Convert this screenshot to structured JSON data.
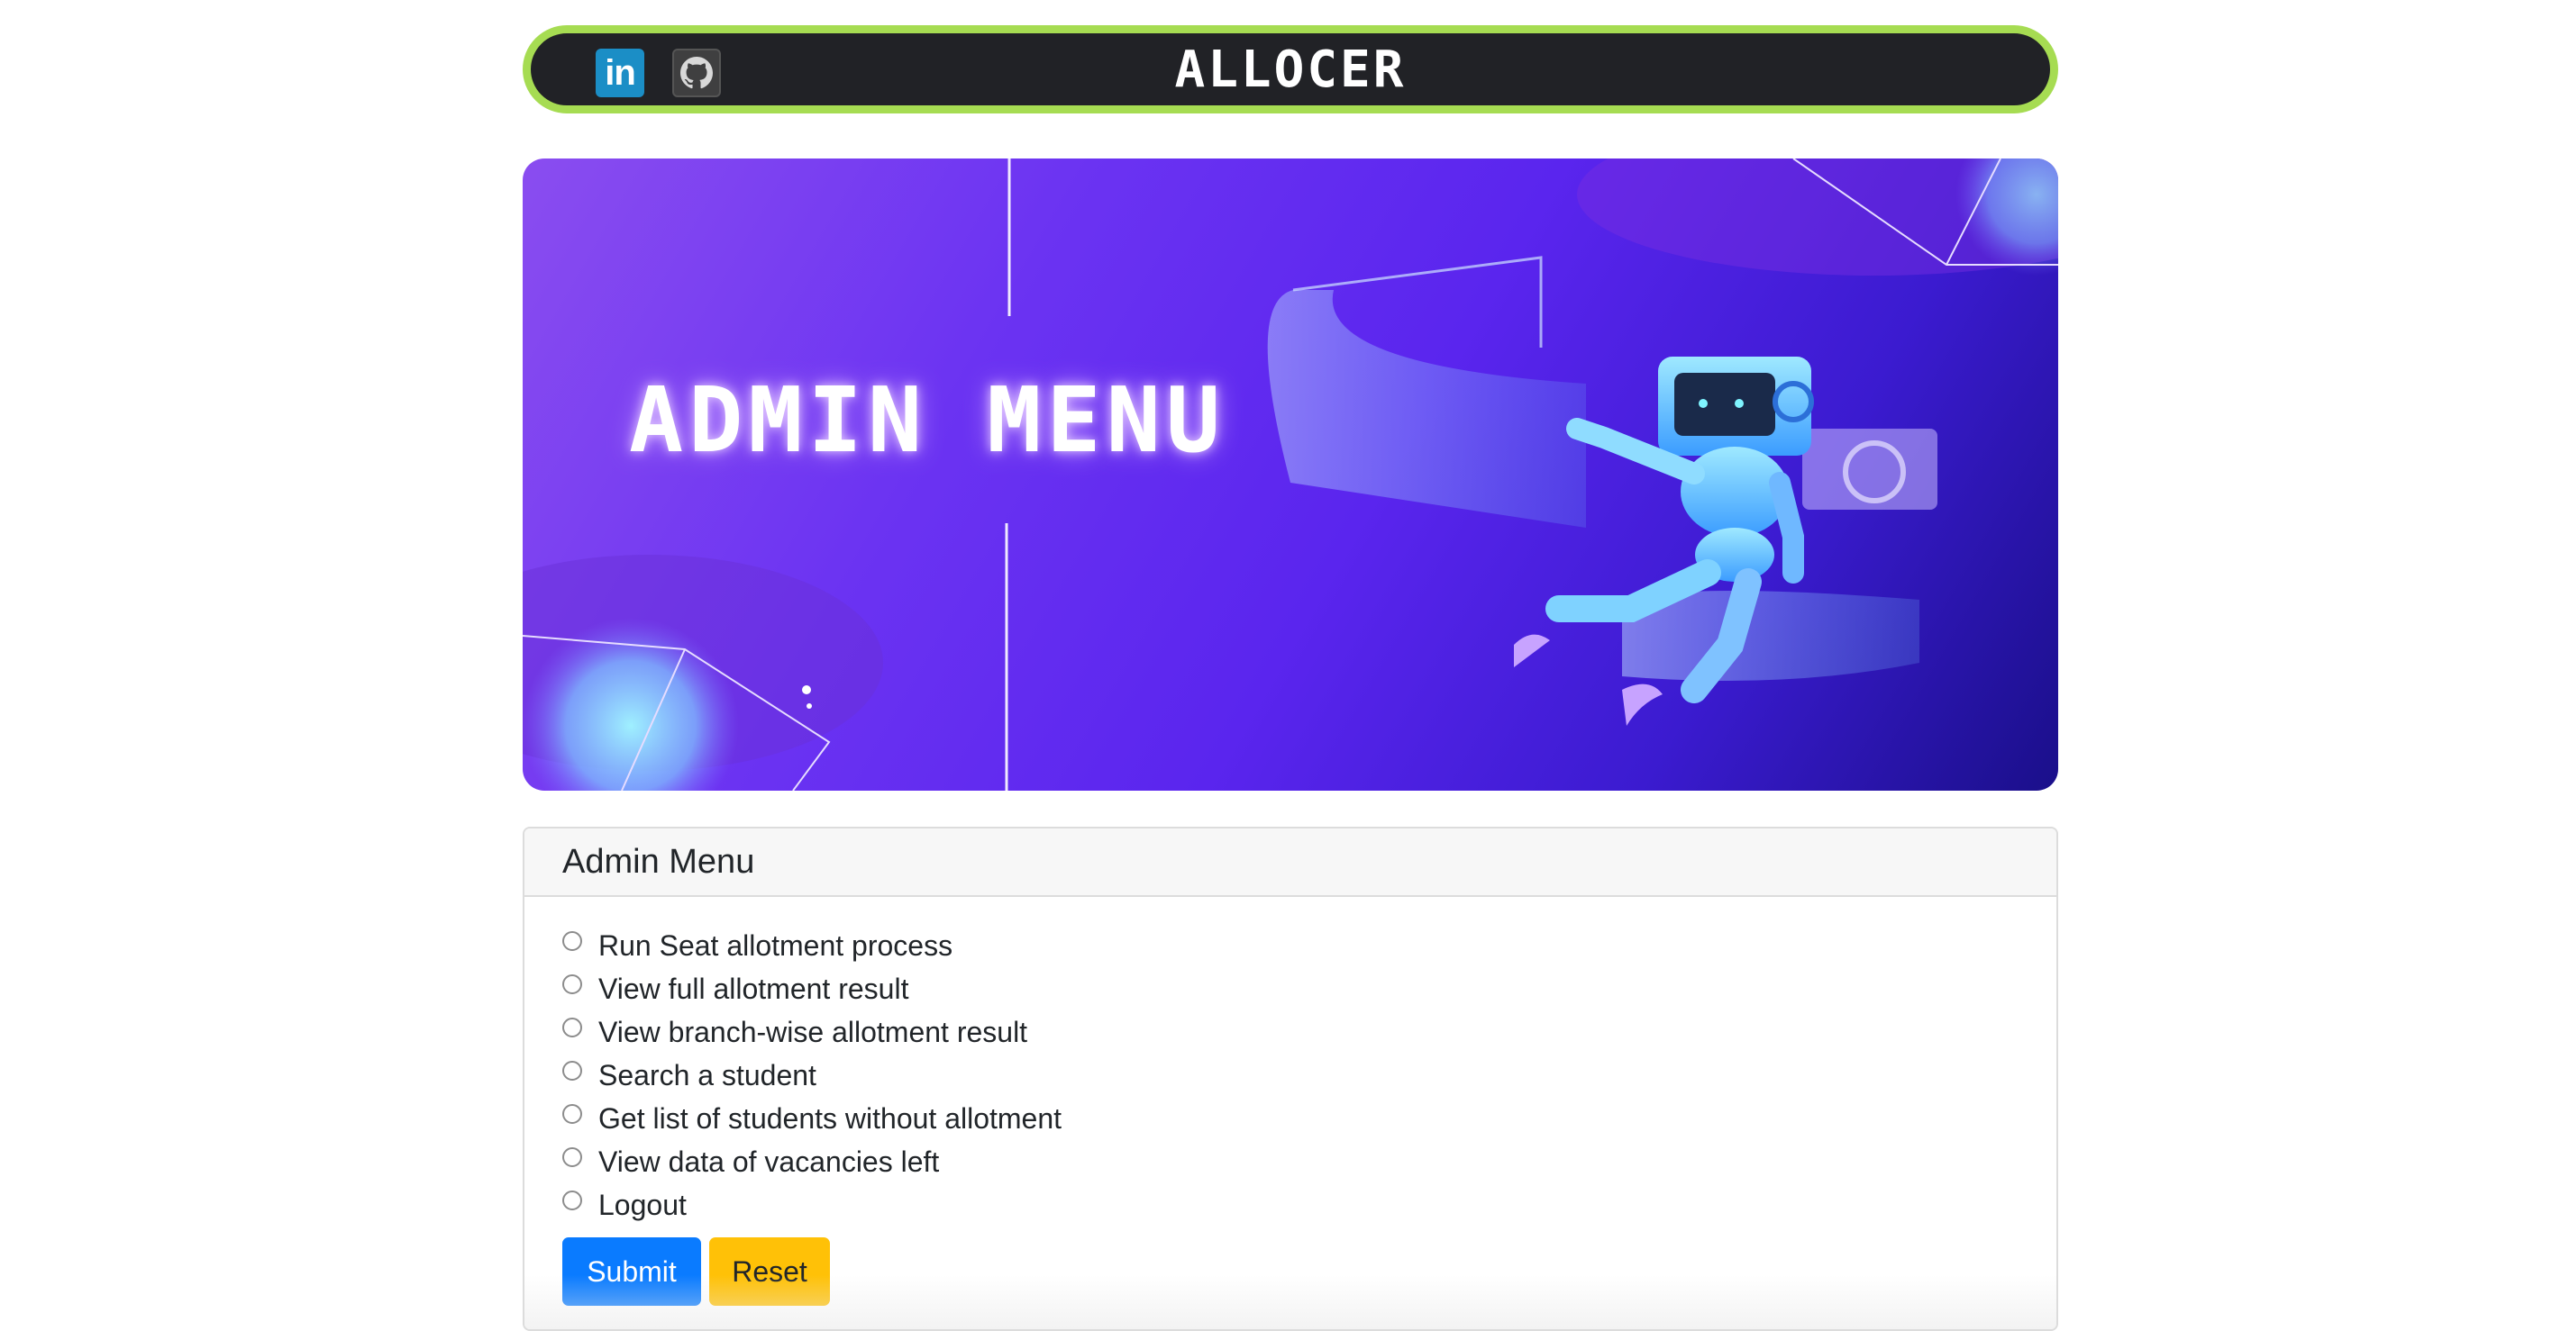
{
  "navbar": {
    "brand": "ALLOCER",
    "linkedin_icon": "linkedin-icon",
    "github_icon": "github-icon",
    "linkedin_text": "in"
  },
  "hero": {
    "title": "ADMIN MENU",
    "illustration": "robot-illustration"
  },
  "menu": {
    "header": "Admin Menu",
    "options": [
      "Run Seat allotment process",
      "View full allotment result",
      "View branch-wise allotment result",
      "Search a student",
      "Get list of students without allotment",
      "View data of vacancies left",
      "Logout"
    ],
    "submit_label": "Submit",
    "reset_label": "Reset"
  },
  "colors": {
    "navbar_border": "#a6dc52",
    "navbar_bg": "#212226",
    "submit": "#0a7bff",
    "reset": "#ffc107"
  }
}
